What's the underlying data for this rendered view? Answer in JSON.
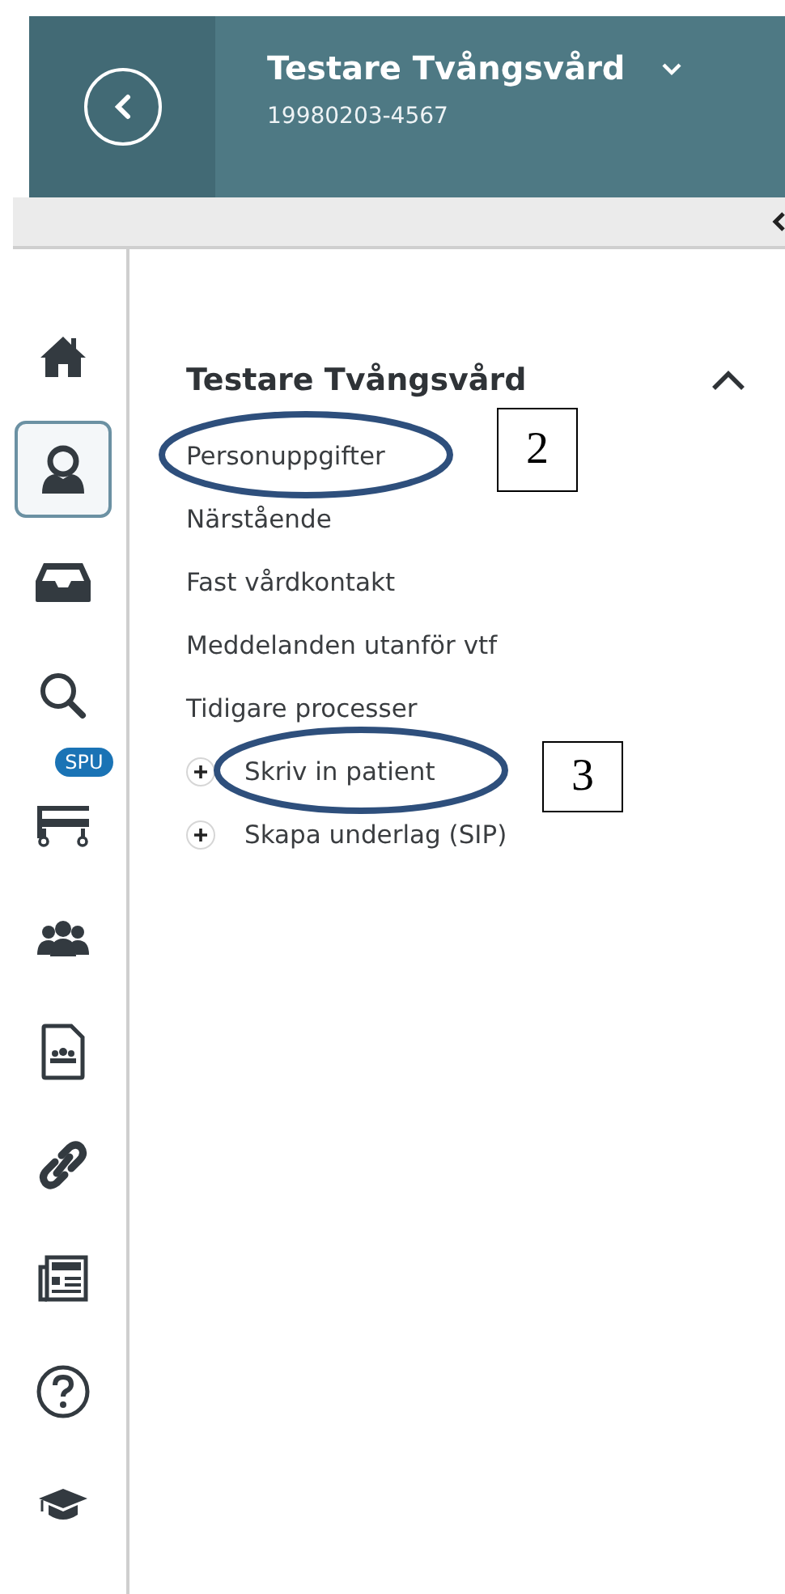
{
  "header": {
    "name": "Testare Tvångsvård",
    "id": "19980203-4567"
  },
  "sidebar": {
    "items": [
      {
        "kind": "home",
        "selected": false
      },
      {
        "kind": "person",
        "selected": true
      },
      {
        "kind": "inbox",
        "selected": false
      },
      {
        "kind": "search",
        "selected": false
      },
      {
        "kind": "bed",
        "selected": false,
        "badge": "SPU"
      },
      {
        "kind": "group",
        "selected": false
      },
      {
        "kind": "document",
        "selected": false
      },
      {
        "kind": "link",
        "selected": false
      },
      {
        "kind": "news",
        "selected": false
      },
      {
        "kind": "help",
        "selected": false
      },
      {
        "kind": "cap",
        "selected": false
      }
    ]
  },
  "section": {
    "title": "Testare Tvångsvård",
    "expanded": true,
    "items": [
      {
        "kind": "link",
        "label": "Personuppgifter",
        "callout": "2"
      },
      {
        "kind": "link",
        "label": "Närstående"
      },
      {
        "kind": "link",
        "label": "Fast vårdkontakt"
      },
      {
        "kind": "link",
        "label": "Meddelanden utanför vtf"
      },
      {
        "kind": "link",
        "label": "Tidigare processer"
      },
      {
        "kind": "action",
        "label": "Skriv in patient",
        "callout": "3"
      },
      {
        "kind": "action",
        "label": "Skapa underlag (SIP)"
      }
    ]
  }
}
